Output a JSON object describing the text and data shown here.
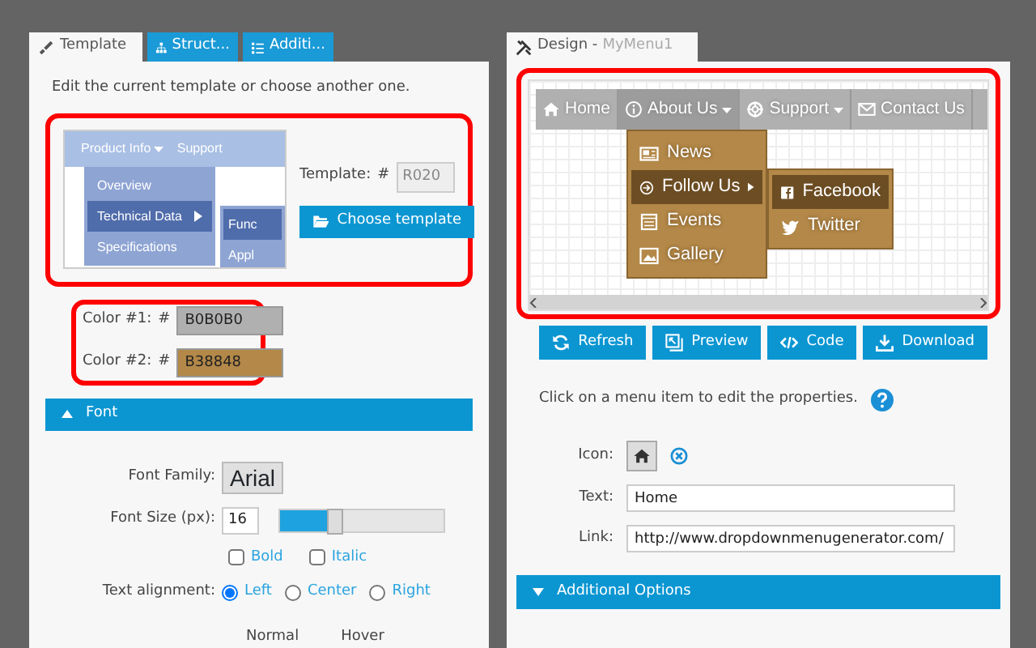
{
  "left_panel": {
    "tabs": [
      {
        "label": "Template",
        "selected": true,
        "kind": "brush"
      },
      {
        "label": "Struct...",
        "selected": false,
        "kind": "sitemap"
      },
      {
        "label": "Additi...",
        "selected": false,
        "kind": "list"
      }
    ],
    "intro": "Edit the current template or choose another one.",
    "template_preview": {
      "menu_bar": [
        "Product Info",
        "Support"
      ],
      "dropdown": [
        {
          "label": "Overview",
          "selected": false,
          "has_submenu": false
        },
        {
          "label": "Technical Data",
          "selected": true,
          "has_submenu": true
        },
        {
          "label": "Specifications",
          "selected": false,
          "has_submenu": false
        }
      ],
      "submenu": [
        {
          "label": "Func",
          "selected": true
        },
        {
          "label": "Appl",
          "selected": false
        }
      ]
    },
    "template_field": {
      "label": "Template:",
      "prefix": "#",
      "value": "R020",
      "disabled": true
    },
    "choose_button": "Choose template",
    "colors": [
      {
        "label": "Color #1:",
        "prefix": "#",
        "value": "B0B0B0",
        "color": "#b0b0b0"
      },
      {
        "label": "Color #2:",
        "prefix": "#",
        "value": "B38848",
        "color": "#b38848"
      }
    ],
    "font_section": {
      "title": "Font",
      "expanded": true,
      "family_label": "Font Family:",
      "family_value": "Arial",
      "size_label": "Font Size (px):",
      "size_value": "16",
      "size_slider": {
        "level": 0.3
      },
      "styles": [
        {
          "label": "Bold",
          "checked": false
        },
        {
          "label": "Italic",
          "checked": false
        }
      ],
      "alignment_label": "Text alignment:",
      "alignments": [
        {
          "label": "Left",
          "selected": true
        },
        {
          "label": "Center",
          "selected": false
        },
        {
          "label": "Right",
          "selected": false
        }
      ],
      "columns": [
        "Normal",
        "Hover"
      ]
    }
  },
  "right_panel": {
    "tab": {
      "title": "Design -",
      "subtitle": "MyMenu1"
    },
    "preview": {
      "menu": [
        {
          "label": "Home",
          "kind": "home",
          "has_dropdown": false,
          "selected": false
        },
        {
          "label": "About Us",
          "kind": "info",
          "has_dropdown": true,
          "selected": true
        },
        {
          "label": "Support",
          "kind": "lifebuoy",
          "has_dropdown": true,
          "selected": false
        },
        {
          "label": "Contact Us",
          "kind": "envelope",
          "has_dropdown": false,
          "selected": false
        }
      ],
      "dropdown": [
        {
          "label": "News",
          "kind": "news",
          "selected": false,
          "has_submenu": false
        },
        {
          "label": "Follow Us",
          "kind": "arrow",
          "selected": true,
          "has_submenu": true
        },
        {
          "label": "Events",
          "kind": "calendar",
          "selected": false,
          "has_submenu": false
        },
        {
          "label": "Gallery",
          "kind": "image",
          "selected": false,
          "has_submenu": false
        }
      ],
      "submenu": [
        {
          "label": "Facebook",
          "kind": "facebook",
          "selected": true
        },
        {
          "label": "Twitter",
          "kind": "bird",
          "selected": false
        }
      ]
    },
    "buttons": [
      {
        "label": "Refresh",
        "kind": "refresh"
      },
      {
        "label": "Preview",
        "kind": "preview"
      },
      {
        "label": "Code",
        "kind": "code"
      },
      {
        "label": "Download",
        "kind": "download"
      }
    ],
    "hint": "Click on a menu item to edit the properties.",
    "properties": {
      "icon_label": "Icon:",
      "kind": "home",
      "text_label": "Text:",
      "text_value": "Home",
      "link_label": "Link:",
      "link_value": "http://www.dropdownmenugenerator.com/"
    },
    "additional": {
      "title": "Additional Options",
      "expanded": false
    }
  }
}
